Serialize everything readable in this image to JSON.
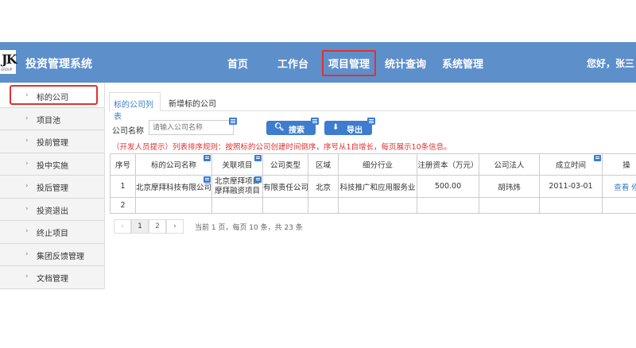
{
  "header": {
    "logo_text": "JK",
    "logo_sub": "GROUP",
    "app_title": "投资管理系统",
    "nav": [
      "首页",
      "工作台",
      "项目管理",
      "统计查询",
      "系统管理"
    ],
    "greeting": "您好，张三"
  },
  "sidebar": {
    "items": [
      {
        "label": "标的公司"
      },
      {
        "label": "项目池"
      },
      {
        "label": "投前管理"
      },
      {
        "label": "投中实施"
      },
      {
        "label": "投后管理"
      },
      {
        "label": "投资退出"
      },
      {
        "label": "终止项目"
      },
      {
        "label": "集团反馈管理"
      },
      {
        "label": "文档管理"
      }
    ]
  },
  "tabs": {
    "list": "标的公司列表",
    "new": "新增标的公司"
  },
  "search": {
    "label": "公司名称",
    "placeholder": "请输入公司名称",
    "search_btn": "搜索",
    "export_btn": "导出"
  },
  "hint": "（开发人员提示）列表排序规则：按照标的公司创建时间倒序，序号从1自增长，每页展示10条信息。",
  "table": {
    "headers": [
      "序号",
      "标的公司名称",
      "关联项目",
      "公司类型",
      "区域",
      "细分行业",
      "注册资本（万元）",
      "公司法人",
      "成立时间",
      "操"
    ],
    "rows": [
      {
        "no": "1",
        "name": "北京摩拜科技有限公司",
        "project_1": "北京摩拜项目",
        "project_2": "摩拜融资项目",
        "type": "有限责任公司",
        "region": "北京",
        "industry": "科技推广和应用服务业",
        "capital": "500.00",
        "legal": "胡玮炜",
        "date": "2011-03-01",
        "action_view": "查看",
        "action_edit": "修"
      },
      {
        "no": "2"
      }
    ]
  },
  "pager": {
    "prev": "‹",
    "pages": [
      "1",
      "2"
    ],
    "next": "›",
    "info": "当前 1 页，每页 10 条，共 23 条"
  },
  "colors": {
    "topbar": "#5d8fca",
    "accent": "#3d7ccf",
    "highlight": "#e03131"
  }
}
